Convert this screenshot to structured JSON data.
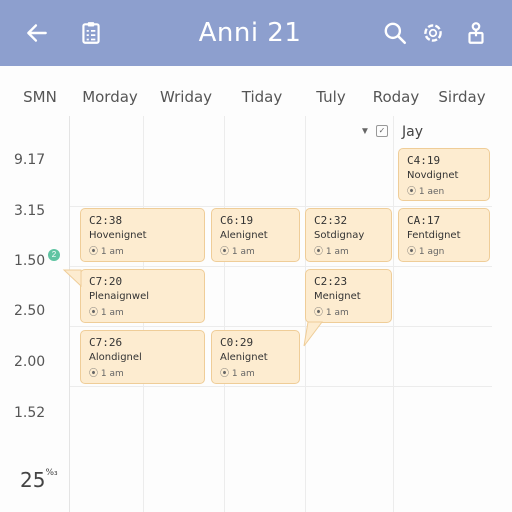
{
  "header": {
    "title": "Anni 21",
    "back_icon": "arrow-left-icon",
    "doc_icon": "clipboard-icon",
    "search_icon": "search-icon",
    "settings_icon": "gear-icon",
    "profile_icon": "share-icon",
    "bar_color": "#8d9fce"
  },
  "days": [
    "SMN",
    "Morday",
    "Wriday",
    "Tiday",
    "Tuly",
    "Roday",
    "Sirday"
  ],
  "times": [
    "9.17",
    "3.15",
    "1.50",
    "2.50",
    "2.00",
    "1.52"
  ],
  "footer_value": "25",
  "footer_unit": "%₃",
  "column_header": {
    "label": "Jay",
    "chevron_icon": "chevron-down-icon",
    "edit_icon": "edit-icon"
  },
  "badge_text": "2",
  "events": [
    {
      "code": "C4:19",
      "name": "Novdignet",
      "meta": "⦿ 1 aen"
    },
    {
      "code": "C2:38",
      "name": "Hovenignet",
      "meta": "⦿ 1 am"
    },
    {
      "code": "C6:19",
      "name": "Alenignet",
      "meta": "⦿ 1 am"
    },
    {
      "code": "C2:32",
      "name": "Sotdignay",
      "meta": "⦿ 1 am"
    },
    {
      "code": "CA:17",
      "name": "Fentdignet",
      "meta": "⦿ 1 agn"
    },
    {
      "code": "C7:20",
      "name": "Plenaignwel",
      "meta": "⦿ 1 am"
    },
    {
      "code": "C2:23",
      "name": "Menignet",
      "meta": "⦿ 1 am"
    },
    {
      "code": "C7:26",
      "name": "Alondignel",
      "meta": "⦿ 1 am"
    },
    {
      "code": "C0:29",
      "name": "Alenignet",
      "meta": "⦿ 1 am"
    }
  ],
  "event_colors": {
    "fill": "#fdecd0",
    "border": "#efcd98"
  }
}
